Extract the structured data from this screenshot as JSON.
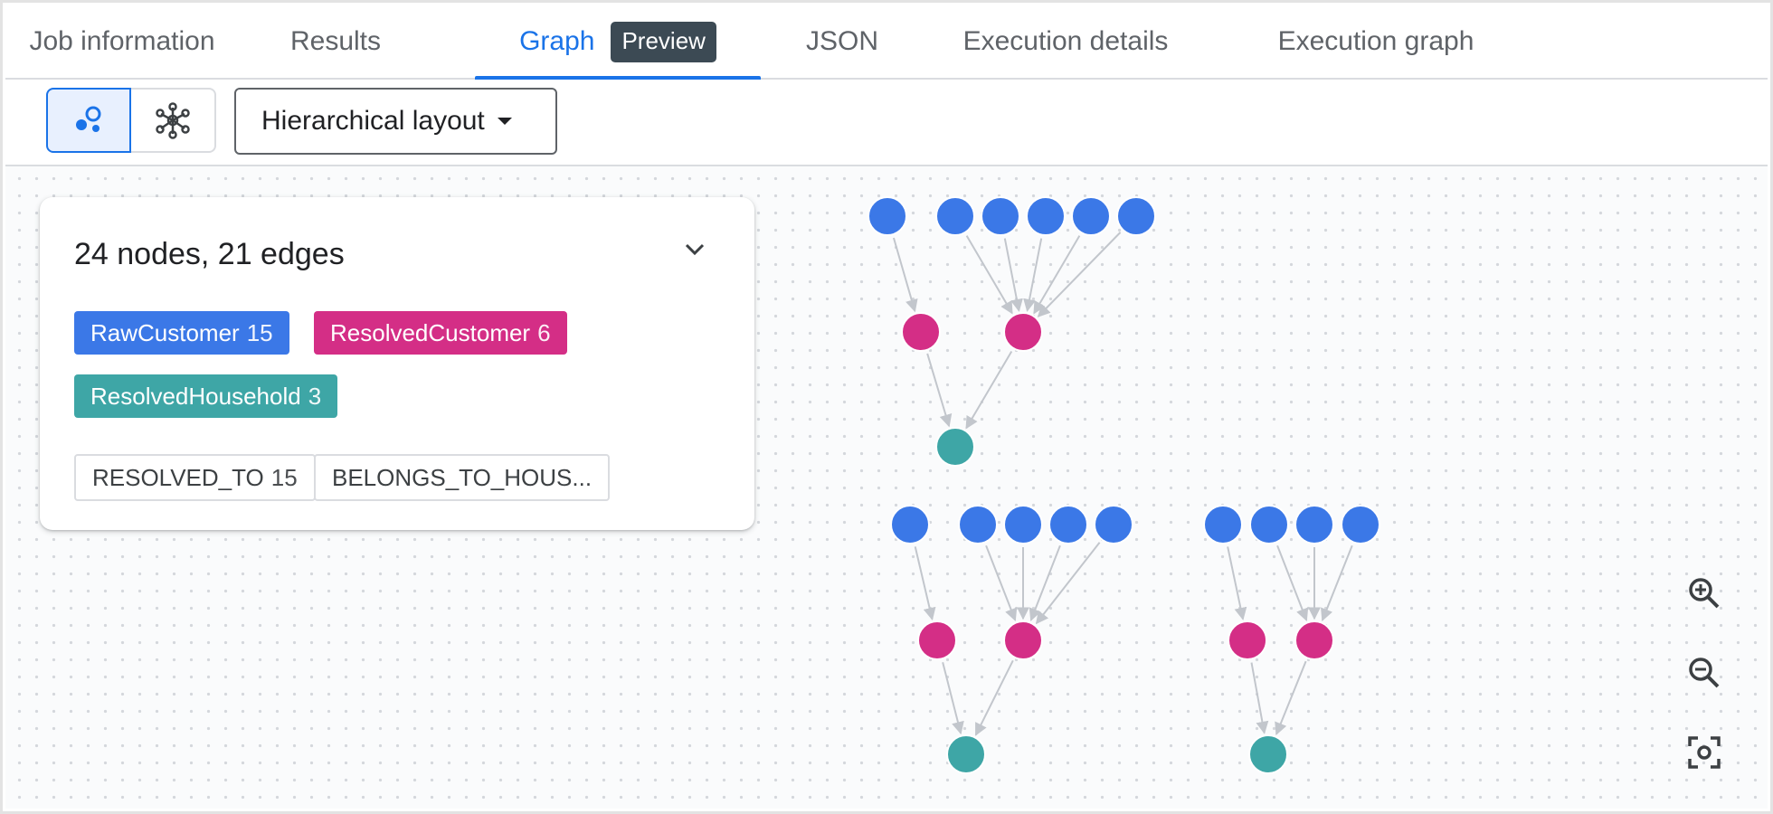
{
  "tabs": [
    {
      "label": "Job information",
      "active": false
    },
    {
      "label": "Results",
      "active": false
    },
    {
      "label": "Graph",
      "active": true,
      "badge": "Preview"
    },
    {
      "label": "JSON",
      "active": false
    },
    {
      "label": "Execution details",
      "active": false
    },
    {
      "label": "Execution graph",
      "active": false
    }
  ],
  "toolbar": {
    "view_buttons": [
      {
        "icon": "schema-view-icon",
        "selected": true
      },
      {
        "icon": "network-view-icon",
        "selected": false
      }
    ],
    "layout_select": {
      "value": "Hierarchical layout"
    }
  },
  "summary": {
    "title": "24 nodes, 21 edges",
    "node_types": [
      {
        "label": "RawCustomer",
        "count": "15",
        "color": "#3b78e7"
      },
      {
        "label": "ResolvedCustomer",
        "count": "6",
        "color": "#d42e86"
      },
      {
        "label": "ResolvedHousehold",
        "count": "3",
        "color": "#3ea6a6"
      }
    ],
    "edge_types": [
      {
        "label": "RESOLVED_TO",
        "count": "15"
      },
      {
        "label": "BELONGS_TO_HOUS..."
      }
    ]
  },
  "graph": {
    "colors": {
      "raw": "#3b78e7",
      "resolved": "#d42e86",
      "household": "#3ea6a6",
      "edge": "#c2c6cc"
    },
    "clusters": [
      {
        "raw_groups": [
          1,
          5
        ],
        "resolved": 2,
        "household": 1
      },
      {
        "raw_groups": [
          1,
          4
        ],
        "resolved": 2,
        "household": 1
      },
      {
        "raw_groups": [
          1,
          3
        ],
        "resolved": 2,
        "household": 1
      }
    ]
  },
  "zoom": {
    "buttons": [
      "zoom-in-icon",
      "zoom-out-icon",
      "fit-screen-icon"
    ]
  }
}
